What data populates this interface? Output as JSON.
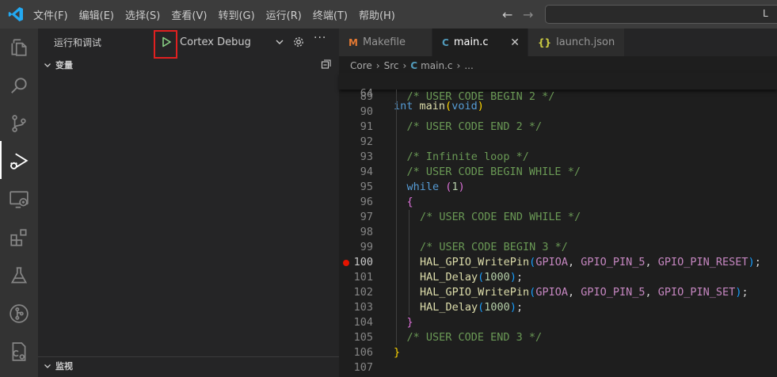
{
  "menu": [
    "文件(F)",
    "编辑(E)",
    "选择(S)",
    "查看(V)",
    "转到(G)",
    "运行(R)",
    "终端(T)",
    "帮助(H)"
  ],
  "search": {
    "text": "L"
  },
  "activity_icons": [
    "explorer-icon",
    "search-icon",
    "source-control-icon",
    "run-debug-icon",
    "remote-explorer-icon",
    "extensions-icon",
    "testing-icon",
    "git-graph-icon",
    "cmake-icon"
  ],
  "sidebar": {
    "title": "运行和调试",
    "config": "Cortex Debug",
    "variables_label": "变量",
    "watch_label": "监视"
  },
  "tabs": [
    {
      "icon": "M",
      "icon_color": "#e37933",
      "label": "Makefile"
    },
    {
      "icon": "C",
      "icon_color": "#519aba",
      "label": "main.c"
    },
    {
      "icon": "{}",
      "icon_color": "#cbcb41",
      "label": "launch.json"
    }
  ],
  "breadcrumb": [
    "Core",
    "Src",
    "main.c",
    "..."
  ],
  "sticky": {
    "num": "64",
    "kw": "int",
    "fn": "main",
    "arg": "void"
  },
  "lines": [
    {
      "num": "89",
      "indent": 1,
      "tokens": [
        {
          "t": "/* USER CODE BEGIN 2 */",
          "c": "cm"
        }
      ]
    },
    {
      "num": "90",
      "indent": 1,
      "tokens": []
    },
    {
      "num": "91",
      "indent": 1,
      "tokens": [
        {
          "t": "/* USER CODE END 2 */",
          "c": "cm"
        }
      ]
    },
    {
      "num": "92",
      "indent": 1,
      "tokens": []
    },
    {
      "num": "93",
      "indent": 1,
      "tokens": [
        {
          "t": "/* Infinite loop */",
          "c": "cm"
        }
      ]
    },
    {
      "num": "94",
      "indent": 1,
      "tokens": [
        {
          "t": "/* USER CODE BEGIN WHILE */",
          "c": "cm"
        }
      ]
    },
    {
      "num": "95",
      "indent": 1,
      "tokens": [
        {
          "t": "while",
          "c": "kw"
        },
        {
          "t": " ",
          "c": "pn"
        },
        {
          "t": "(",
          "c": "br2"
        },
        {
          "t": "1",
          "c": "num"
        },
        {
          "t": ")",
          "c": "br2"
        }
      ]
    },
    {
      "num": "96",
      "indent": 1,
      "tokens": [
        {
          "t": "{",
          "c": "br2"
        }
      ]
    },
    {
      "num": "97",
      "indent": 2,
      "tokens": [
        {
          "t": "/* USER CODE END WHILE */",
          "c": "cm"
        }
      ]
    },
    {
      "num": "98",
      "indent": 2,
      "tokens": []
    },
    {
      "num": "99",
      "indent": 2,
      "tokens": [
        {
          "t": "/* USER CODE BEGIN 3 */",
          "c": "cm"
        }
      ]
    },
    {
      "num": "100",
      "indent": 2,
      "bp": true,
      "tokens": [
        {
          "t": "HAL_GPIO_WritePin",
          "c": "fn"
        },
        {
          "t": "(",
          "c": "br3"
        },
        {
          "t": "GPIOA",
          "c": "mac"
        },
        {
          "t": ", ",
          "c": "pn"
        },
        {
          "t": "GPIO_PIN_5",
          "c": "mac"
        },
        {
          "t": ", ",
          "c": "pn"
        },
        {
          "t": "GPIO_PIN_RESET",
          "c": "mac"
        },
        {
          "t": ")",
          "c": "br3"
        },
        {
          "t": ";",
          "c": "pn"
        }
      ]
    },
    {
      "num": "101",
      "indent": 2,
      "tokens": [
        {
          "t": "HAL_Delay",
          "c": "fn"
        },
        {
          "t": "(",
          "c": "br3"
        },
        {
          "t": "1000",
          "c": "num"
        },
        {
          "t": ")",
          "c": "br3"
        },
        {
          "t": ";",
          "c": "pn"
        }
      ]
    },
    {
      "num": "102",
      "indent": 2,
      "tokens": [
        {
          "t": "HAL_GPIO_WritePin",
          "c": "fn"
        },
        {
          "t": "(",
          "c": "br3"
        },
        {
          "t": "GPIOA",
          "c": "mac"
        },
        {
          "t": ", ",
          "c": "pn"
        },
        {
          "t": "GPIO_PIN_5",
          "c": "mac"
        },
        {
          "t": ", ",
          "c": "pn"
        },
        {
          "t": "GPIO_PIN_SET",
          "c": "mac"
        },
        {
          "t": ")",
          "c": "br3"
        },
        {
          "t": ";",
          "c": "pn"
        }
      ]
    },
    {
      "num": "103",
      "indent": 2,
      "tokens": [
        {
          "t": "HAL_Delay",
          "c": "fn"
        },
        {
          "t": "(",
          "c": "br3"
        },
        {
          "t": "1000",
          "c": "num"
        },
        {
          "t": ")",
          "c": "br3"
        },
        {
          "t": ";",
          "c": "pn"
        }
      ]
    },
    {
      "num": "104",
      "indent": 1,
      "tokens": [
        {
          "t": "}",
          "c": "br2"
        }
      ]
    },
    {
      "num": "105",
      "indent": 1,
      "tokens": [
        {
          "t": "/* USER CODE END 3 */",
          "c": "cm"
        }
      ]
    },
    {
      "num": "106",
      "indent": 0,
      "tokens": [
        {
          "t": "}",
          "c": "br1"
        }
      ]
    },
    {
      "num": "107",
      "indent": 0,
      "tokens": []
    }
  ]
}
